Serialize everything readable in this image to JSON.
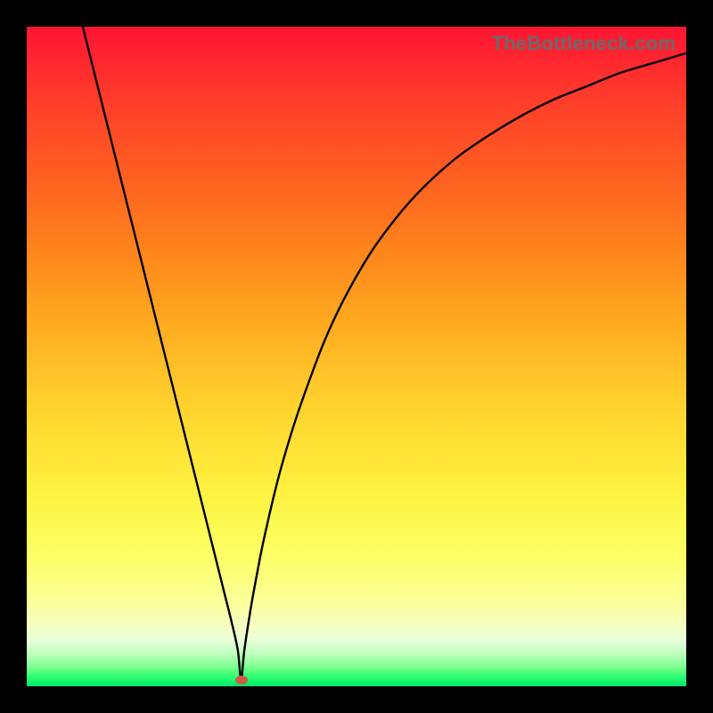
{
  "watermark": "TheBottleneck.com",
  "chart_data": {
    "type": "line",
    "title": "",
    "xlabel": "",
    "ylabel": "",
    "xlim": [
      0,
      100
    ],
    "ylim": [
      0,
      100
    ],
    "grid": false,
    "legend": false,
    "annotations": [],
    "marker": {
      "x": 32.5,
      "y": 1.0,
      "color": "#cc5a4a"
    },
    "series": [
      {
        "name": "curve",
        "color": "#000000",
        "x": [
          8.5,
          10,
          12,
          14,
          16,
          18,
          20,
          22,
          24,
          26,
          28,
          30,
          31,
          32,
          32.5,
          33,
          34,
          35,
          36,
          38,
          40,
          42,
          45,
          48,
          52,
          56,
          60,
          65,
          70,
          75,
          80,
          85,
          90,
          95,
          100
        ],
        "y": [
          100,
          94,
          86,
          78,
          70,
          62,
          54,
          46,
          38,
          30,
          22,
          14,
          10,
          5.5,
          1.0,
          5.5,
          12,
          17.5,
          22.5,
          31,
          38,
          44,
          52,
          58.5,
          65.5,
          71,
          75.5,
          80,
          83.5,
          86.5,
          89,
          91,
          93,
          94.5,
          96
        ]
      }
    ],
    "background_gradient": {
      "type": "vertical",
      "stops": [
        {
          "pos": 0,
          "color": "#ff1433"
        },
        {
          "pos": 50,
          "color": "#ffc828"
        },
        {
          "pos": 80,
          "color": "#fcff64"
        },
        {
          "pos": 100,
          "color": "#00e86a"
        }
      ]
    }
  }
}
